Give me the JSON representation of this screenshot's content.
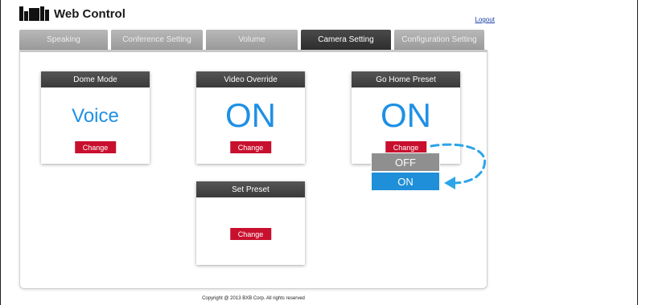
{
  "header": {
    "app_title": "Web Control",
    "logo_text": "BXB",
    "logout_label": "Logout"
  },
  "tabs": [
    {
      "label": "Speaking",
      "active": false
    },
    {
      "label": "Conference Setting",
      "active": false
    },
    {
      "label": "Volume",
      "active": false
    },
    {
      "label": "Camera Setting",
      "active": true
    },
    {
      "label": "Configuration Setting",
      "active": false
    }
  ],
  "cards": {
    "dome_mode": {
      "title": "Dome Mode",
      "value": "Voice",
      "button": "Change"
    },
    "video_override": {
      "title": "Video Override",
      "value": "ON",
      "button": "Change"
    },
    "go_home_preset": {
      "title": "Go Home Preset",
      "value": "ON",
      "button": "Change"
    },
    "set_preset": {
      "title": "Set Preset",
      "button": "Change"
    }
  },
  "dropdown": {
    "options": [
      "OFF",
      "ON"
    ],
    "selected": "ON"
  },
  "footer": {
    "copyright": "Copyright @ 2013 BXB Corp. All rights reserved"
  },
  "colors": {
    "accent_blue": "#1e90e6",
    "button_red": "#c8102e",
    "tab_active": "#3a3a3a",
    "tab_inactive": "#a8a8a8"
  }
}
